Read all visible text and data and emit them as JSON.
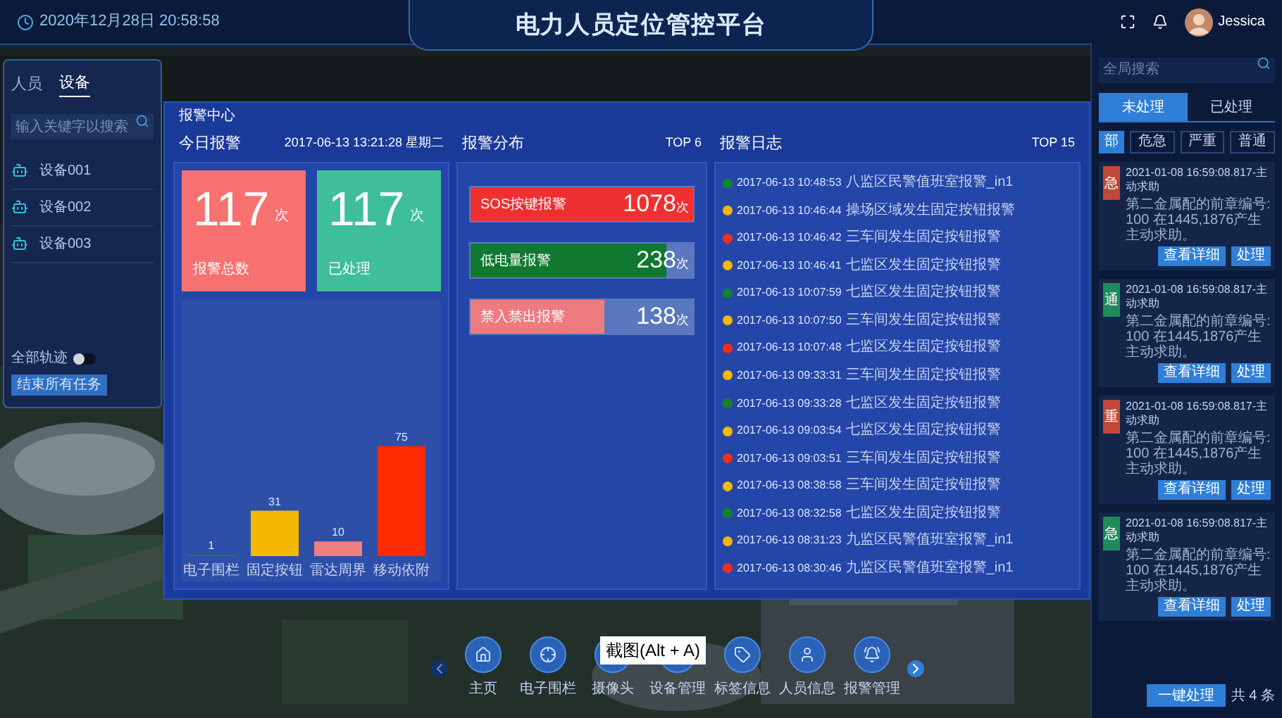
{
  "header": {
    "clock": "2020年12月28日 20:58:58",
    "title": "电力人员定位管控平台",
    "user": "Jessica"
  },
  "left_panel": {
    "tabs": [
      {
        "label": "人员",
        "selected": false
      },
      {
        "label": "设备",
        "selected": true
      }
    ],
    "search": {
      "placeholder": "输入关键字以搜索"
    },
    "items": [
      "设备001",
      "设备002",
      "设备003"
    ],
    "toggle": {
      "label": "全部轨迹",
      "on": false
    },
    "button": "结束所有任务"
  },
  "modal": {
    "title": "报警中心",
    "today": {
      "title": "今日报警",
      "datetime": "2017-06-13 13:21:28 星期二",
      "cards": [
        {
          "value": "117",
          "unit": "次",
          "label": "报警总数",
          "color": "#f87171"
        },
        {
          "value": "117",
          "unit": "次",
          "label": "已处理",
          "color": "#3fbf98"
        }
      ],
      "chart_data": {
        "type": "bar",
        "categories": [
          "电子围栏",
          "固定按钮",
          "雷达周界",
          "移动依附"
        ],
        "stacked": true,
        "data_labels": true,
        "series": [
          {
            "color": "#18803a",
            "values": [
              1,
              null,
              null,
              null
            ]
          },
          {
            "color": "#f5b800",
            "values": [
              null,
              31,
              null,
              null
            ]
          },
          {
            "color": "#f08080",
            "values": [
              null,
              null,
              10,
              null
            ]
          },
          {
            "color": "#ff2a00",
            "values": [
              null,
              null,
              null,
              75
            ]
          }
        ]
      }
    },
    "distribution": {
      "title": "报警分布",
      "badge": "TOP 6",
      "rows": [
        {
          "label": "SOS按键报警",
          "value": "1078",
          "unit": "次",
          "level": 1,
          "color": "#f03030"
        },
        {
          "label": "低电量报警",
          "value": "238",
          "unit": "次",
          "level": 0.88,
          "color": "#11792f"
        },
        {
          "label": "禁入禁出报警",
          "value": "138",
          "unit": "次",
          "level": 0.6,
          "color": "#ee7b80"
        }
      ]
    },
    "log": {
      "title": "报警日志",
      "badge": "TOP 15",
      "entries": [
        {
          "time": "2017-06-13 10:48:53",
          "text": "八监区民警值班室报警_in1",
          "color": "#14832a"
        },
        {
          "time": "2017-06-13 10:46:44",
          "text": "操场区域发生固定按钮报警",
          "color": "#f5b800"
        },
        {
          "time": "2017-06-13 10:46:42",
          "text": "三车间发生固定按钮报警",
          "color": "#f0301a"
        },
        {
          "time": "2017-06-13 10:46:41",
          "text": "七监区发生固定按钮报警",
          "color": "#f5b800"
        },
        {
          "time": "2017-06-13 10:07:59",
          "text": "七监区发生固定按钮报警",
          "color": "#14832a"
        },
        {
          "time": "2017-06-13 10:07:50",
          "text": "三车间发生固定按钮报警",
          "color": "#f5b800"
        },
        {
          "time": "2017-06-13 10:07:48",
          "text": "七监区发生固定按钮报警",
          "color": "#f0301a"
        },
        {
          "time": "2017-06-13 09:33:31",
          "text": "三车间发生固定按钮报警",
          "color": "#f5b800"
        },
        {
          "time": "2017-06-13 09:33:28",
          "text": "七监区发生固定按钮报警",
          "color": "#14832a"
        },
        {
          "time": "2017-06-13 09:03:54",
          "text": "七监区发生固定按钮报警",
          "color": "#f5b800"
        },
        {
          "time": "2017-06-13 09:03:51",
          "text": "三车间发生固定按钮报警",
          "color": "#f0301a"
        },
        {
          "time": "2017-06-13 08:38:58",
          "text": "三车间发生固定按钮报警",
          "color": "#f5b800"
        },
        {
          "time": "2017-06-13 08:32:58",
          "text": "七监区发生固定按钮报警",
          "color": "#14832a"
        },
        {
          "time": "2017-06-13 08:31:23",
          "text": "九监区民警值班室报警_in1",
          "color": "#f5b800"
        },
        {
          "time": "2017-06-13 08:30:46",
          "text": "九监区民警值班室报警_in1",
          "color": "#f0301a"
        }
      ]
    }
  },
  "right_panel": {
    "search": {
      "placeholder": "全局搜索"
    },
    "tabs": [
      {
        "label": "未处理",
        "selected": true
      },
      {
        "label": "已处理",
        "selected": false
      }
    ],
    "filters": [
      {
        "label": "部",
        "selected": true
      },
      {
        "label": "危急",
        "selected": false
      },
      {
        "label": "严重",
        "selected": false
      },
      {
        "label": "普通",
        "selected": false
      }
    ],
    "alerts": [
      {
        "badge": "急",
        "color": "#c0473a",
        "title": "2021-01-08 16:59:08.817-主动求助",
        "text": "第二金属配的前章编号:100 在1445,1876产生主动求助。",
        "actions": [
          "查看详细",
          "处理"
        ]
      },
      {
        "badge": "通",
        "color": "#1f8a5a",
        "title": "2021-01-08 16:59:08.817-主动求助",
        "text": "第二金属配的前章编号:100 在1445,1876产生主动求助。",
        "actions": [
          "查看详细",
          "处理"
        ]
      },
      {
        "badge": "重",
        "color": "#c0473a",
        "title": "2021-01-08 16:59:08.817-主动求助",
        "text": "第二金属配的前章编号:100 在1445,1876产生主动求助。",
        "actions": [
          "查看详细",
          "处理"
        ]
      },
      {
        "badge": "急",
        "color": "#1f8a5a",
        "title": "2021-01-08 16:59:08.817-主动求助",
        "text": "第二金属配的前章编号:100 在1445,1876产生主动求助。",
        "actions": [
          "查看详细",
          "处理"
        ]
      }
    ],
    "bulk_button": "一键处理",
    "count": "共 4 条"
  },
  "nav": [
    {
      "label": "主页"
    },
    {
      "label": "电子围栏"
    },
    {
      "label": "摄像头"
    },
    {
      "label": "设备管理"
    },
    {
      "label": "标签信息"
    },
    {
      "label": "人员信息"
    },
    {
      "label": "报警管理"
    }
  ],
  "tooltip": "截图(Alt + A)"
}
